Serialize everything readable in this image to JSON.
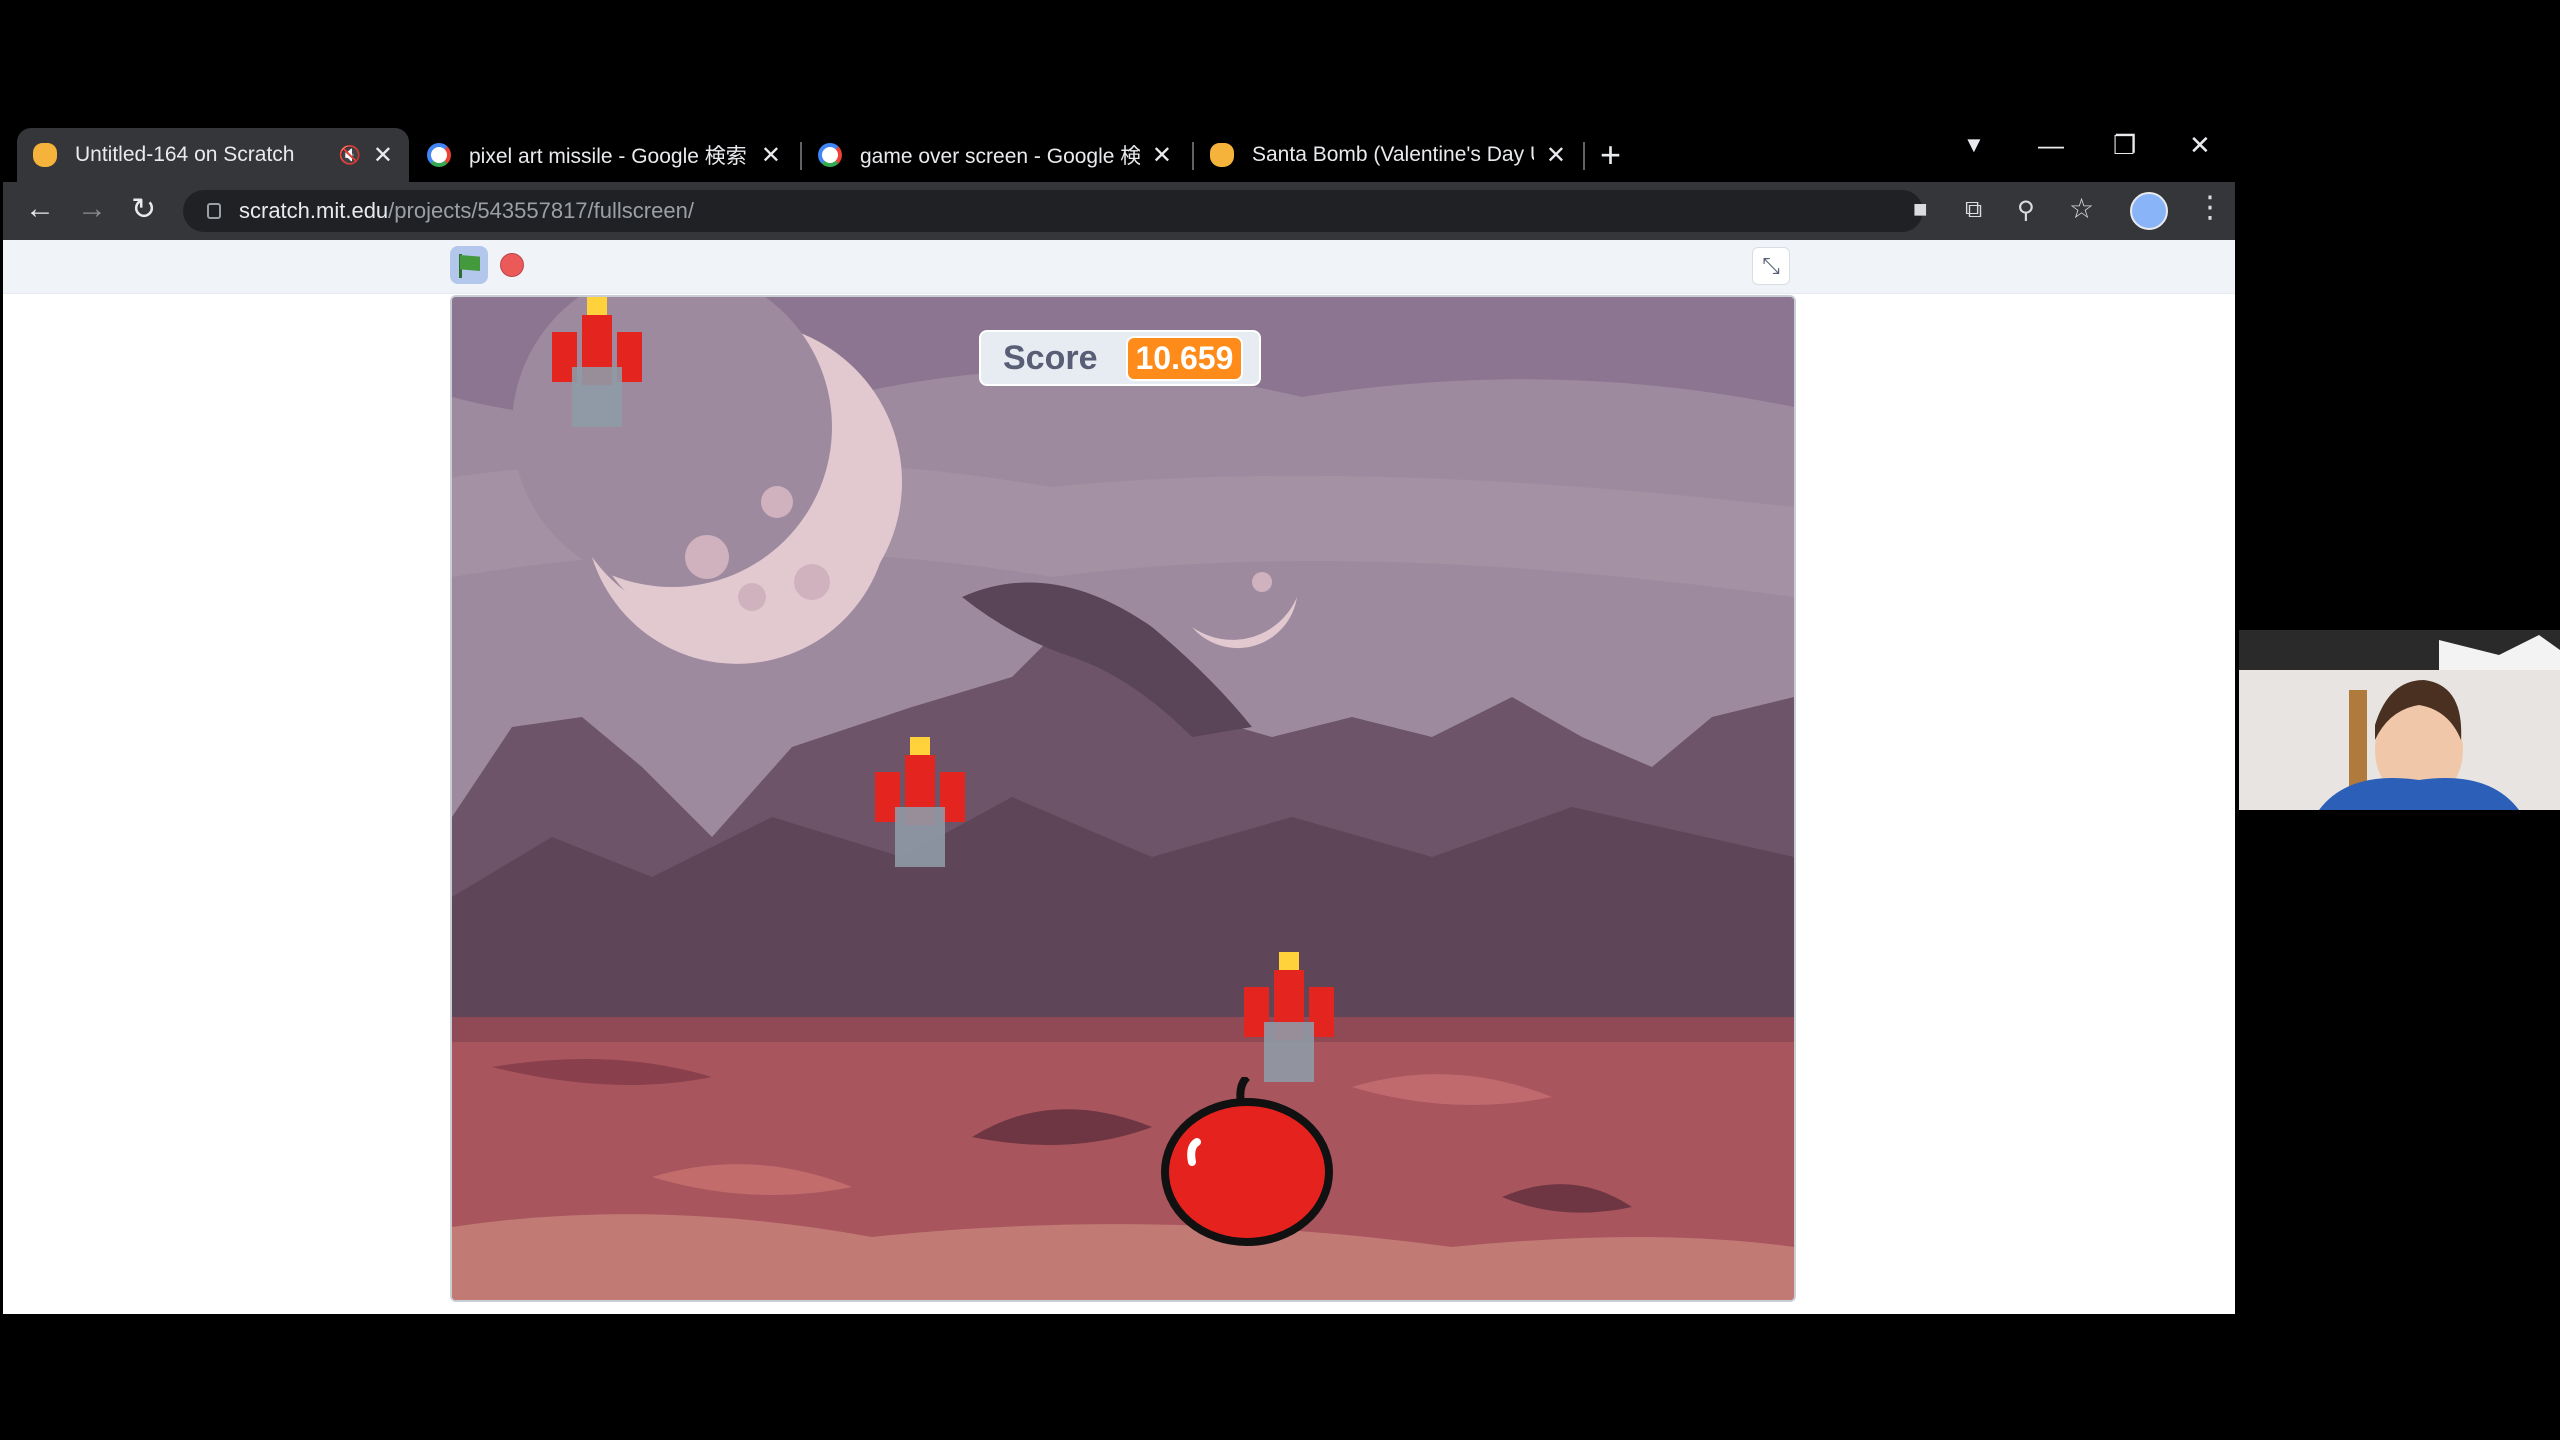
{
  "browser": {
    "tabs": [
      {
        "label": "Untitled-164 on Scratch",
        "icon": "scratch-icon",
        "active": true,
        "muted_icon": "🔇"
      },
      {
        "label": "pixel art missile - Google 検索",
        "icon": "google-icon"
      },
      {
        "label": "game over screen - Google 検索",
        "icon": "google-icon"
      },
      {
        "label": "Santa Bomb (Valentine's Day Upd",
        "icon": "scratch-icon"
      }
    ],
    "close_glyph": "✕",
    "new_tab_glyph": "+",
    "window_controls": {
      "minimize": "—",
      "restore": "❐",
      "close": "✕"
    },
    "url": {
      "domain": "scratch.mit.edu",
      "path": "/projects/543557817/fullscreen/"
    },
    "toolbar_icons": {
      "back": "←",
      "forward": "→",
      "reload": "↻",
      "camera": "■",
      "translate": "⧉",
      "zoom": "⚲",
      "star": "☆",
      "menu": "⋮",
      "tab_search": "▼"
    }
  },
  "scratch": {
    "score_label": "Score",
    "score_value": "10.659",
    "unfullscreen_glyph": "⤡"
  },
  "colors": {
    "tab_bar": "#000000",
    "toolbar": "#35363a",
    "score_orange": "#ff8c1a",
    "stage_sky": "#9e8a9e",
    "ground": "#a8555e"
  }
}
